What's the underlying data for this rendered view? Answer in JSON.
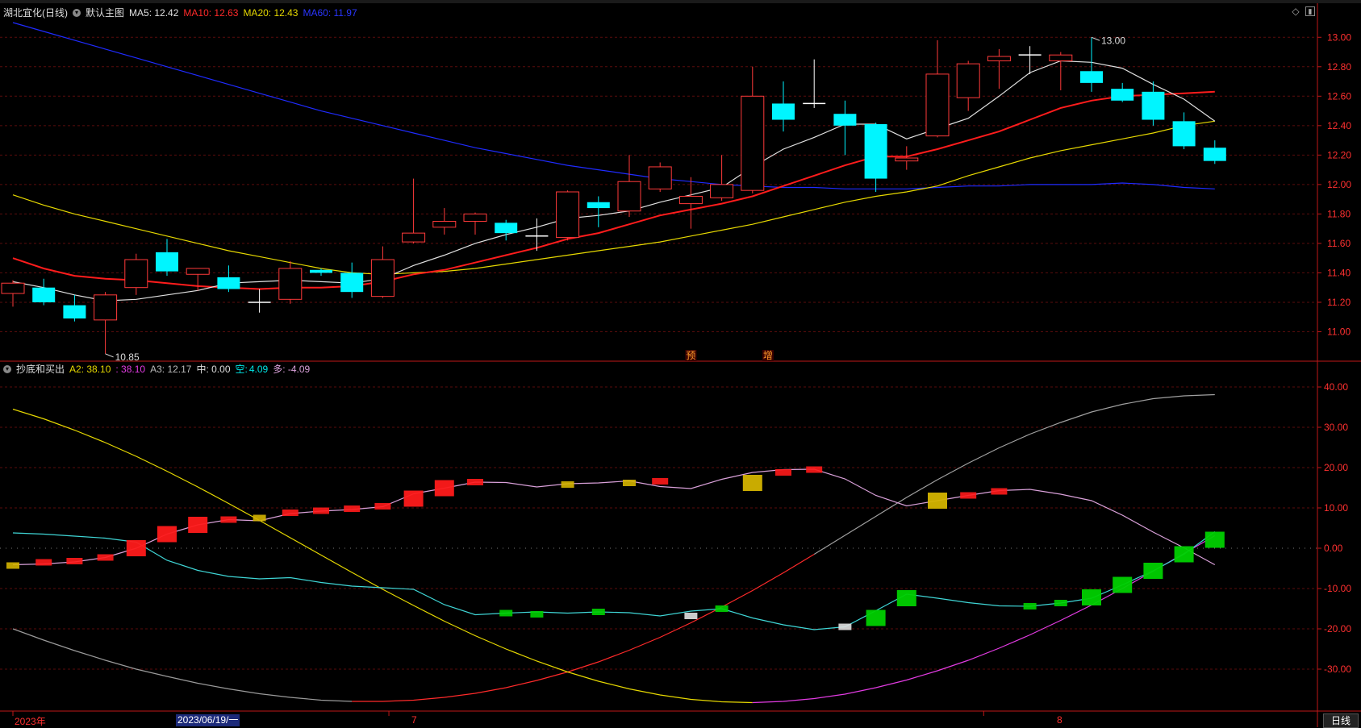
{
  "main_header": {
    "stock_name": "湖北宜化(日线)",
    "main_chart_label": "默认主图",
    "ma5": "MA5: 12.42",
    "ma10": "MA10: 12.63",
    "ma20": "MA20: 12.43",
    "ma60": "MA60: 11.97"
  },
  "sub_header": {
    "indicator_name": "抄底和买出",
    "a2": "A2: 38.10",
    "a2b": ": 38.10",
    "a3": "A3: 12.17",
    "zhong": "中: 0.00",
    "kong_label": "空:",
    "kong_value": "4.09",
    "duo": "多: -4.09"
  },
  "footer": {
    "year_label": "2023年",
    "cursor_date": "2023/06/19/一",
    "month_7": "7",
    "month_8": "8",
    "period_button": "日线"
  },
  "colors": {
    "up": "#ff3a3a",
    "down": "#00f5ff",
    "ma5": "#e0e0e0",
    "ma10": "#ff1c1c",
    "ma20": "#e6d800",
    "ma60": "#1f2bff",
    "axis": "#c01818",
    "grid": "#5a0c0c"
  },
  "chart_data": [
    {
      "type": "candlestick",
      "title": "湖北宜化(日线)",
      "ylim": [
        10.8,
        13.1
      ],
      "y_ticks": [
        11.0,
        11.2,
        11.4,
        11.6,
        11.8,
        12.0,
        12.2,
        12.4,
        12.6,
        12.8,
        13.0
      ],
      "high_annotation": "13.00",
      "low_annotation": "10.85",
      "signal_labels": [
        "预",
        "增"
      ],
      "candles": [
        {
          "o": 11.26,
          "h": 11.35,
          "l": 11.17,
          "c": 11.33
        },
        {
          "o": 11.3,
          "h": 11.36,
          "l": 11.18,
          "c": 11.2
        },
        {
          "o": 11.18,
          "h": 11.25,
          "l": 11.07,
          "c": 11.09
        },
        {
          "o": 11.08,
          "h": 11.27,
          "l": 10.85,
          "c": 11.25
        },
        {
          "o": 11.3,
          "h": 11.53,
          "l": 11.25,
          "c": 11.49
        },
        {
          "o": 11.54,
          "h": 11.63,
          "l": 11.38,
          "c": 11.41
        },
        {
          "o": 11.39,
          "h": 11.43,
          "l": 11.28,
          "c": 11.43
        },
        {
          "o": 11.37,
          "h": 11.45,
          "l": 11.27,
          "c": 11.29
        },
        {
          "o": 11.2,
          "h": 11.29,
          "l": 11.13,
          "c": 11.19
        },
        {
          "o": 11.22,
          "h": 11.48,
          "l": 11.19,
          "c": 11.43
        },
        {
          "o": 11.42,
          "h": 11.43,
          "l": 11.38,
          "c": 11.4
        },
        {
          "o": 11.4,
          "h": 11.47,
          "l": 11.23,
          "c": 11.27
        },
        {
          "o": 11.24,
          "h": 11.58,
          "l": 11.23,
          "c": 11.49
        },
        {
          "o": 11.61,
          "h": 12.04,
          "l": 11.6,
          "c": 11.67
        },
        {
          "o": 11.71,
          "h": 11.84,
          "l": 11.66,
          "c": 11.75
        },
        {
          "o": 11.75,
          "h": 11.81,
          "l": 11.66,
          "c": 11.8
        },
        {
          "o": 11.74,
          "h": 11.76,
          "l": 11.62,
          "c": 11.67
        },
        {
          "o": 11.65,
          "h": 11.77,
          "l": 11.55,
          "c": 11.65
        },
        {
          "o": 11.64,
          "h": 11.96,
          "l": 11.62,
          "c": 11.95
        },
        {
          "o": 11.88,
          "h": 11.92,
          "l": 11.71,
          "c": 11.84
        },
        {
          "o": 11.82,
          "h": 12.2,
          "l": 11.78,
          "c": 12.02
        },
        {
          "o": 11.97,
          "h": 12.15,
          "l": 11.95,
          "c": 12.12
        },
        {
          "o": 11.87,
          "h": 12.05,
          "l": 11.7,
          "c": 11.92
        },
        {
          "o": 11.91,
          "h": 12.2,
          "l": 11.89,
          "c": 12.0
        },
        {
          "o": 11.96,
          "h": 12.8,
          "l": 11.94,
          "c": 12.6
        },
        {
          "o": 12.55,
          "h": 12.7,
          "l": 12.36,
          "c": 12.44
        },
        {
          "o": 12.55,
          "h": 12.85,
          "l": 12.52,
          "c": 12.55
        },
        {
          "o": 12.48,
          "h": 12.57,
          "l": 12.2,
          "c": 12.4
        },
        {
          "o": 12.41,
          "h": 12.42,
          "l": 11.95,
          "c": 12.04
        },
        {
          "o": 12.16,
          "h": 12.26,
          "l": 12.1,
          "c": 12.18
        },
        {
          "o": 12.33,
          "h": 12.98,
          "l": 12.32,
          "c": 12.75
        },
        {
          "o": 12.59,
          "h": 12.84,
          "l": 12.5,
          "c": 12.82
        },
        {
          "o": 12.84,
          "h": 12.92,
          "l": 12.65,
          "c": 12.87
        },
        {
          "o": 12.88,
          "h": 12.94,
          "l": 12.75,
          "c": 12.88
        },
        {
          "o": 12.84,
          "h": 12.9,
          "l": 12.64,
          "c": 12.88
        },
        {
          "o": 12.77,
          "h": 13.0,
          "l": 12.63,
          "c": 12.69
        },
        {
          "o": 12.65,
          "h": 12.69,
          "l": 12.56,
          "c": 12.57
        },
        {
          "o": 12.63,
          "h": 12.7,
          "l": 12.4,
          "c": 12.44
        },
        {
          "o": 12.43,
          "h": 12.49,
          "l": 12.24,
          "c": 12.26
        },
        {
          "o": 12.25,
          "h": 12.3,
          "l": 12.14,
          "c": 12.16
        }
      ],
      "series": [
        {
          "name": "MA5",
          "values": [
            11.34,
            11.3,
            11.25,
            11.21,
            11.22,
            11.25,
            11.28,
            11.33,
            11.34,
            11.35,
            11.34,
            11.33,
            11.36,
            11.45,
            11.52,
            11.6,
            11.66,
            11.71,
            11.77,
            11.79,
            11.82,
            11.88,
            11.93,
            11.98,
            12.12,
            12.24,
            12.32,
            12.41,
            12.41,
            12.31,
            12.38,
            12.45,
            12.6,
            12.76,
            12.84,
            12.83,
            12.79,
            12.68,
            12.58,
            12.43
          ]
        },
        {
          "name": "MA10",
          "values": [
            11.5,
            11.43,
            11.38,
            11.36,
            11.35,
            11.33,
            11.31,
            11.3,
            11.29,
            11.3,
            11.3,
            11.31,
            11.34,
            11.39,
            11.42,
            11.47,
            11.52,
            11.57,
            11.63,
            11.67,
            11.73,
            11.79,
            11.83,
            11.87,
            11.92,
            11.99,
            12.06,
            12.13,
            12.19,
            12.19,
            12.24,
            12.3,
            12.36,
            12.44,
            12.52,
            12.57,
            12.6,
            12.61,
            12.62,
            12.63
          ]
        },
        {
          "name": "MA20",
          "values": [
            11.93,
            11.86,
            11.8,
            11.75,
            11.7,
            11.65,
            11.6,
            11.55,
            11.51,
            11.47,
            11.43,
            11.4,
            11.39,
            11.4,
            11.41,
            11.43,
            11.46,
            11.49,
            11.52,
            11.55,
            11.58,
            11.61,
            11.65,
            11.69,
            11.73,
            11.78,
            11.83,
            11.88,
            11.92,
            11.95,
            11.99,
            12.06,
            12.12,
            12.18,
            12.23,
            12.27,
            12.31,
            12.35,
            12.4,
            12.43
          ]
        },
        {
          "name": "MA60",
          "values": [
            13.1,
            13.04,
            12.98,
            12.92,
            12.86,
            12.8,
            12.74,
            12.68,
            12.62,
            12.56,
            12.5,
            12.45,
            12.4,
            12.35,
            12.3,
            12.25,
            12.21,
            12.17,
            12.13,
            12.1,
            12.07,
            12.04,
            12.02,
            12.0,
            11.99,
            11.98,
            11.98,
            11.97,
            11.97,
            11.97,
            11.98,
            11.99,
            11.99,
            12.0,
            12.0,
            12.0,
            12.01,
            12.0,
            11.98,
            11.97
          ]
        }
      ]
    },
    {
      "type": "line",
      "title": "抄底和买出",
      "ylim": [
        -40,
        42
      ],
      "y_ticks": [
        40,
        30,
        20,
        10,
        0,
        -10,
        -20,
        -30
      ],
      "y_tick_labels": [
        "40.00",
        "30.00",
        "20.00",
        "10.00",
        "0.00",
        "-10.00",
        "-20.00",
        "-30.00"
      ],
      "series": [
        {
          "name": "A2",
          "values": [
            -20,
            -22.8,
            -25.4,
            -27.8,
            -30,
            -31.8,
            -33.5,
            -34.9,
            -36.1,
            -37,
            -37.7,
            -38,
            -38,
            -37.7,
            -37,
            -36,
            -34.6,
            -32.8,
            -30.7,
            -28.2,
            -25.3,
            -22.1,
            -18.5,
            -14.6,
            -10.5,
            -6.1,
            -1.5,
            3.2,
            7.9,
            12.6,
            17,
            21.1,
            24.9,
            28.3,
            31.2,
            33.8,
            35.7,
            37.1,
            37.8,
            38.1
          ]
        },
        {
          "name": "A3",
          "values": [
            34.5,
            32.1,
            29.3,
            26.2,
            22.8,
            19.1,
            15.2,
            11.1,
            6.9,
            2.6,
            -1.7,
            -6,
            -10.2,
            -14.2,
            -18.1,
            -21.7,
            -25,
            -28,
            -30.7,
            -33,
            -34.9,
            -36.4,
            -37.5,
            -38.1,
            -38.3,
            -38,
            -37.3,
            -36.2,
            -34.6,
            -32.7,
            -30.4,
            -27.8,
            -24.8,
            -21.5,
            -17.9,
            -14.1,
            -10,
            -5.7,
            -1.3,
            3.1
          ]
        },
        {
          "name": "中",
          "values": [
            -4.3,
            -5.1,
            -5.9,
            -6.6,
            -7.2,
            -7.7,
            -8,
            -8.2,
            -8.3,
            -8.2,
            -8,
            -7.6,
            -7,
            -6.3,
            -5.5,
            -4.6,
            -3.6,
            -2.5,
            -1.4,
            -0.3,
            0.8,
            1.9,
            3,
            4,
            4.9,
            5.8,
            6.6,
            7.3,
            7.9,
            8.4,
            8.8,
            9.1,
            9.3,
            9.4,
            9.4,
            9.3,
            9.1,
            8.8,
            8.4,
            7.9
          ]
        },
        {
          "name": "多",
          "values": [
            -4.1,
            -3.9,
            -3.4,
            -2.3,
            0,
            3.5,
            5.8,
            7.1,
            6.8,
            8.6,
            9.2,
            9.6,
            10.3,
            13.5,
            14.9,
            16.4,
            16.3,
            15.2,
            16,
            16.2,
            16.7,
            15.3,
            14.8,
            17.1,
            18.8,
            19.5,
            19.6,
            17.2,
            13.1,
            10.5,
            11.8,
            13.1,
            14.3,
            14.6,
            13.4,
            11.8,
            8.2,
            4,
            0.1,
            -4.09
          ]
        },
        {
          "name": "空",
          "values": [
            3.8,
            3.5,
            3,
            2.5,
            1.5,
            -3,
            -5.5,
            -7,
            -7.6,
            -7.3,
            -8.5,
            -9.4,
            -9.8,
            -10.2,
            -14,
            -16.5,
            -16.1,
            -15.8,
            -16.1,
            -15.8,
            -16,
            -16.8,
            -15.6,
            -15,
            -17.3,
            -19,
            -20.2,
            -19.5,
            -15.5,
            -11.4,
            -12.4,
            -13.5,
            -14.3,
            -14.4,
            -13.6,
            -12.4,
            -9.1,
            -5.6,
            -1.5,
            4.09
          ]
        }
      ],
      "bars": [
        {
          "v": -4.3,
          "t": "y"
        },
        {
          "v": -3.5,
          "t": "r"
        },
        {
          "v": -3.2,
          "t": "r"
        },
        {
          "v": -2.3,
          "t": "r"
        },
        {
          "v": 0,
          "t": "R"
        },
        {
          "v": 3.5,
          "t": "R"
        },
        {
          "v": 5.8,
          "t": "R"
        },
        {
          "v": 7.1,
          "t": "r"
        },
        {
          "v": 7.5,
          "t": "y"
        },
        {
          "v": 8.8,
          "t": "r"
        },
        {
          "v": 9.3,
          "t": "r"
        },
        {
          "v": 9.8,
          "t": "r"
        },
        {
          "v": 10.4,
          "t": "r"
        },
        {
          "v": 12.3,
          "t": "R"
        },
        {
          "v": 14.9,
          "t": "R"
        },
        {
          "v": 16.4,
          "t": "r"
        },
        {
          "v": -16.1,
          "t": "g"
        },
        {
          "v": -16.4,
          "t": "g"
        },
        {
          "v": 15.8,
          "t": "y"
        },
        {
          "v": -15.8,
          "t": "g"
        },
        {
          "v": 16.2,
          "t": "y"
        },
        {
          "v": 16.6,
          "t": "r"
        },
        {
          "v": -16.8,
          "t": "w"
        },
        {
          "v": -15,
          "t": "g"
        },
        {
          "v": 16.2,
          "t": "Y"
        },
        {
          "v": 18.8,
          "t": "r"
        },
        {
          "v": 19.5,
          "t": "r"
        },
        {
          "v": -19.5,
          "t": "w"
        },
        {
          "v": -17.3,
          "t": "G"
        },
        {
          "v": -12.4,
          "t": "G"
        },
        {
          "v": 11.8,
          "t": "Y"
        },
        {
          "v": 13.1,
          "t": "r"
        },
        {
          "v": 14.1,
          "t": "r"
        },
        {
          "v": -14.4,
          "t": "g"
        },
        {
          "v": -13.6,
          "t": "g"
        },
        {
          "v": -12.2,
          "t": "G"
        },
        {
          "v": -9.1,
          "t": "G"
        },
        {
          "v": -5.6,
          "t": "G"
        },
        {
          "v": -1.5,
          "t": "G"
        },
        {
          "v": 2.1,
          "t": "G"
        }
      ]
    }
  ]
}
